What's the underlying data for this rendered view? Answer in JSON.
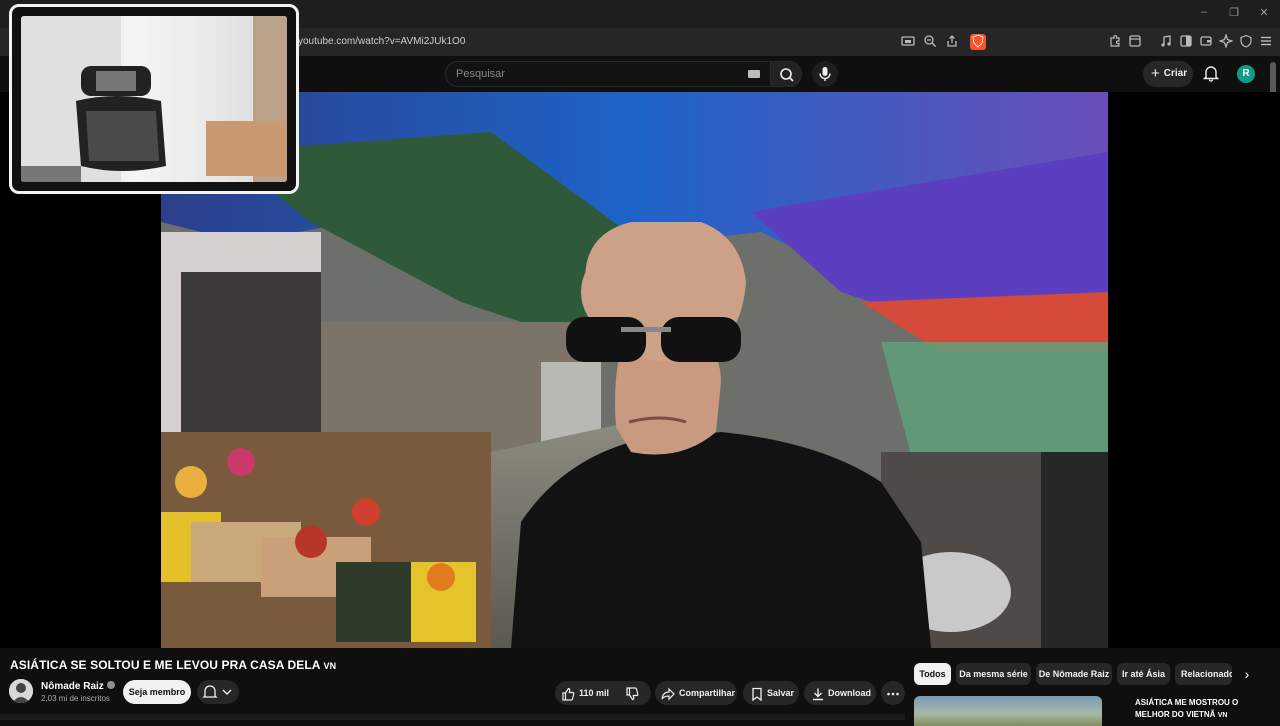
{
  "browser": {
    "url": "youtube.com/watch?v=AVMi2JUk1O0",
    "window_controls": [
      "–",
      "❐",
      "✕"
    ]
  },
  "header": {
    "search_placeholder": "Pesquisar",
    "create_label": "Criar",
    "avatar_letter": "R"
  },
  "video": {
    "title": "ASIÁTICA SE SOLTOU E ME LEVOU PRA CASA DELA",
    "title_flag": "VN"
  },
  "channel": {
    "name": "Nômade Raiz",
    "subscribers": "2,03 mi de inscritos",
    "member_label": "Seja membro"
  },
  "actions": {
    "likes": "110 mil",
    "share_label": "Compartilhar",
    "save_label": "Salvar",
    "download_label": "Download"
  },
  "chips": [
    "Todos",
    "Da mesma série",
    "De Nômade Raiz",
    "Ir até Ásia",
    "Relacionado"
  ],
  "recommendation": {
    "title": "ASIÁTICA ME MOSTROU O MELHOR DO VIETNÃ",
    "flag": "VN"
  },
  "colors": {
    "background": "#0f0f0f",
    "chip_bg": "#272727",
    "accent_red": "#cc0000"
  }
}
